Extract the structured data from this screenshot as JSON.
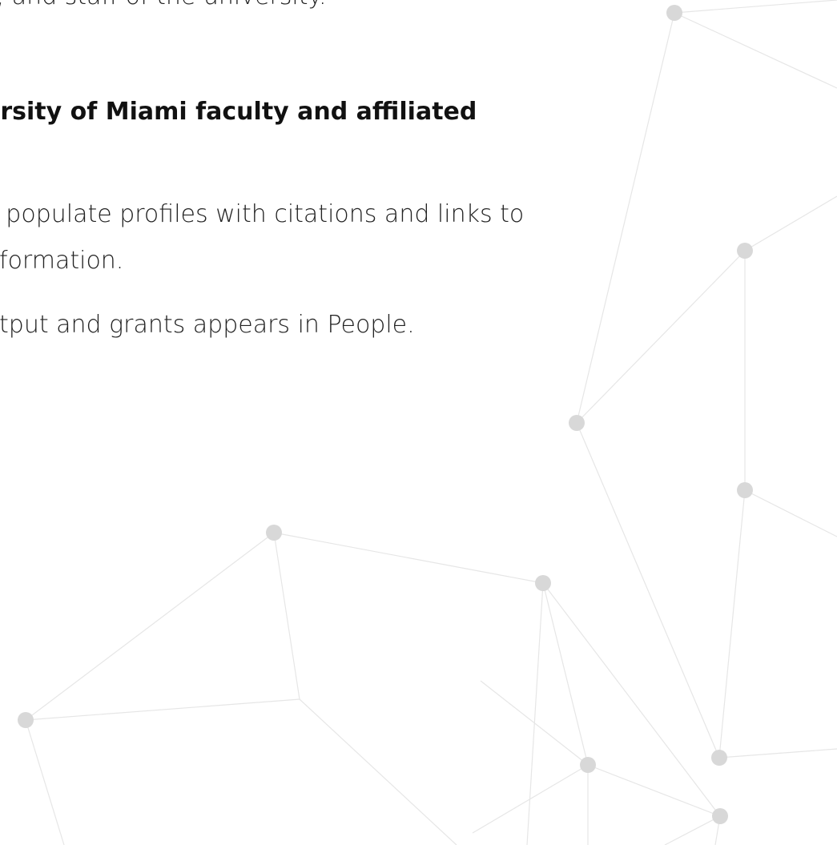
{
  "text": {
    "line1": "s, and staff of the university.",
    "heading": "ersity of Miami faculty and affiliated",
    "line3": "y populate profiles with citations and links to",
    "line4": "nformation.",
    "line5": "utput and grants appears in People."
  },
  "background": {
    "node_color": "#d8d8d8",
    "edge_color": "#e6e6e6"
  }
}
